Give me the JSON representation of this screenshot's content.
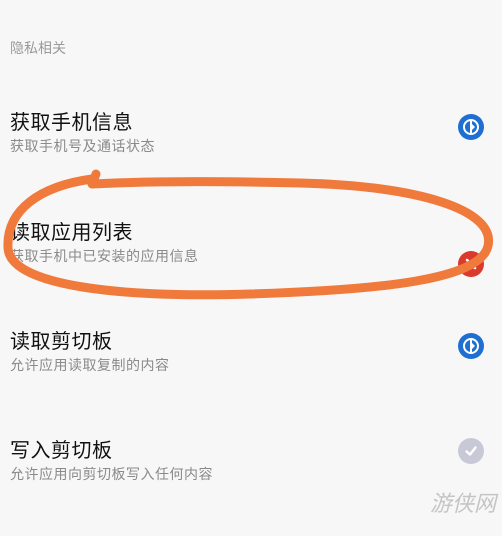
{
  "section": {
    "title": "隐私相关"
  },
  "permissions": [
    {
      "title": "获取手机信息",
      "desc": "获取手机号及通话状态",
      "status": "allow",
      "status_icon": "shield-icon"
    },
    {
      "title": "读取应用列表",
      "desc": "获取手机中已安装的应用信息",
      "status": "deny",
      "status_icon": "close-icon"
    },
    {
      "title": "读取剪切板",
      "desc": "允许应用读取复制的内容",
      "status": "allow",
      "status_icon": "shield-icon"
    },
    {
      "title": "写入剪切板",
      "desc": "允许应用向剪切板写入任何内容",
      "status": "ask",
      "status_icon": "check-icon"
    }
  ],
  "colors": {
    "allow": "#1e6fd1",
    "deny": "#d93a2b",
    "ask": "#c7c9d6",
    "annotation": "#f07a3c"
  },
  "watermark": "游侠网"
}
